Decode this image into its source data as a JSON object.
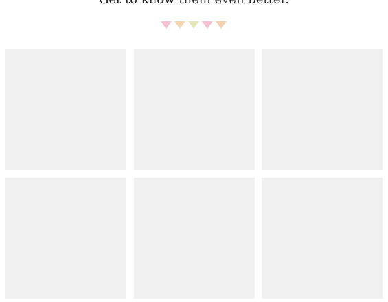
{
  "header": {
    "subtitle": "Get to know them even better."
  },
  "bunting": {
    "icon": "bunting-flags-icon",
    "colors": [
      "#f2b6c9",
      "#f3cfa3",
      "#dfe0ad",
      "#f2b6c9",
      "#f5c89f"
    ]
  },
  "gallery": {
    "tile_color": "#f0f0f0",
    "tiles": [
      {
        "id": "tile-1"
      },
      {
        "id": "tile-2"
      },
      {
        "id": "tile-3"
      },
      {
        "id": "tile-4"
      },
      {
        "id": "tile-5"
      },
      {
        "id": "tile-6"
      }
    ]
  }
}
